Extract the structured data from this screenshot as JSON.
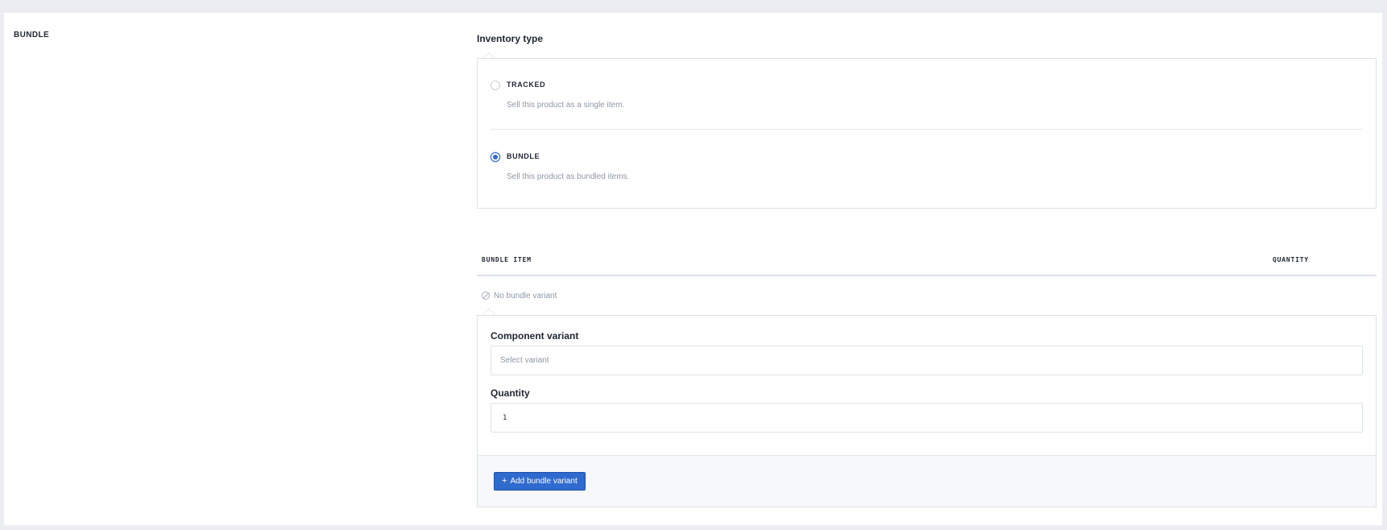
{
  "section": {
    "label": "BUNDLE"
  },
  "inventory": {
    "title": "Inventory type",
    "options": [
      {
        "label": "TRACKED",
        "description": "Sell this product as a single item.",
        "checked": false
      },
      {
        "label": "BUNDLE",
        "description": "Sell this product as bundled items.",
        "checked": true
      }
    ]
  },
  "table": {
    "columns": [
      "BUNDLE ITEM",
      "QUANTITY"
    ],
    "empty_text": "No bundle variant",
    "empty_icon": "ban-icon"
  },
  "form": {
    "component_label": "Component variant",
    "component_placeholder": "Select variant",
    "quantity_label": "Quantity",
    "quantity_value": "1",
    "add_button": "Add bundle variant",
    "add_icon": "plus-icon"
  },
  "colors": {
    "accent": "#2f6acf",
    "page_bg": "#ebedf2",
    "muted_text": "#8e97a8",
    "border": "#dde1e8"
  }
}
